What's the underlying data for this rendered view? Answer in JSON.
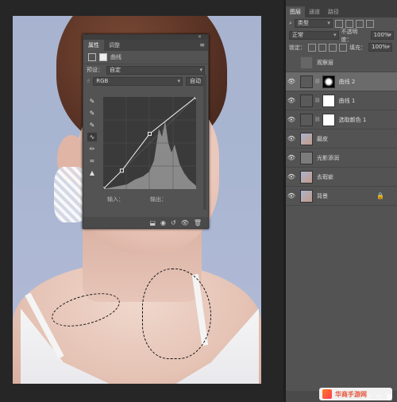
{
  "properties": {
    "tabs": [
      "属性",
      "调整"
    ],
    "header_label": "曲线",
    "preset_label": "预设：",
    "preset_value": "自定",
    "channel_value": "RGB",
    "auto_button": "自动",
    "input_label": "输入：",
    "output_label": "输出：",
    "curve_points": [
      [
        0,
        0
      ],
      [
        0.2,
        0.2
      ],
      [
        0.5,
        0.6
      ],
      [
        1,
        1
      ]
    ],
    "tool_icons": [
      "target-adjust-icon",
      "eyedropper-black-icon",
      "eyedropper-gray-icon",
      "eyedropper-white-icon",
      "curve-point-icon",
      "pencil-icon",
      "smooth-icon",
      "clipping-warning-icon"
    ],
    "footer_icons": [
      "clip-to-layer-icon",
      "view-previous-icon",
      "reset-icon",
      "visibility-icon",
      "delete-icon"
    ]
  },
  "layers_panel": {
    "tabs": [
      "图层",
      "通道",
      "路径"
    ],
    "filter_label": "类型",
    "blend_mode": "正常",
    "opacity_label": "不透明度：",
    "opacity_value": "100%",
    "lock_label": "锁定：",
    "fill_label": "填充：",
    "fill_value": "100%",
    "layers": [
      {
        "name": "观察层",
        "visible": false,
        "kind": "group"
      },
      {
        "name": "曲线 2",
        "visible": true,
        "kind": "adjustment-curves-mask",
        "selected": true
      },
      {
        "name": "曲线 1",
        "visible": true,
        "kind": "adjustment-curves"
      },
      {
        "name": "选取颜色 1",
        "visible": true,
        "kind": "adjustment-selective-color"
      },
      {
        "name": "磨皮",
        "visible": true,
        "kind": "pixel"
      },
      {
        "name": "光影添润",
        "visible": true,
        "kind": "gray-pixel"
      },
      {
        "name": "去瑕疵",
        "visible": true,
        "kind": "pixel"
      },
      {
        "name": "背景",
        "visible": true,
        "kind": "background",
        "locked": true
      }
    ]
  },
  "watermark": {
    "text": "华商手游网"
  }
}
